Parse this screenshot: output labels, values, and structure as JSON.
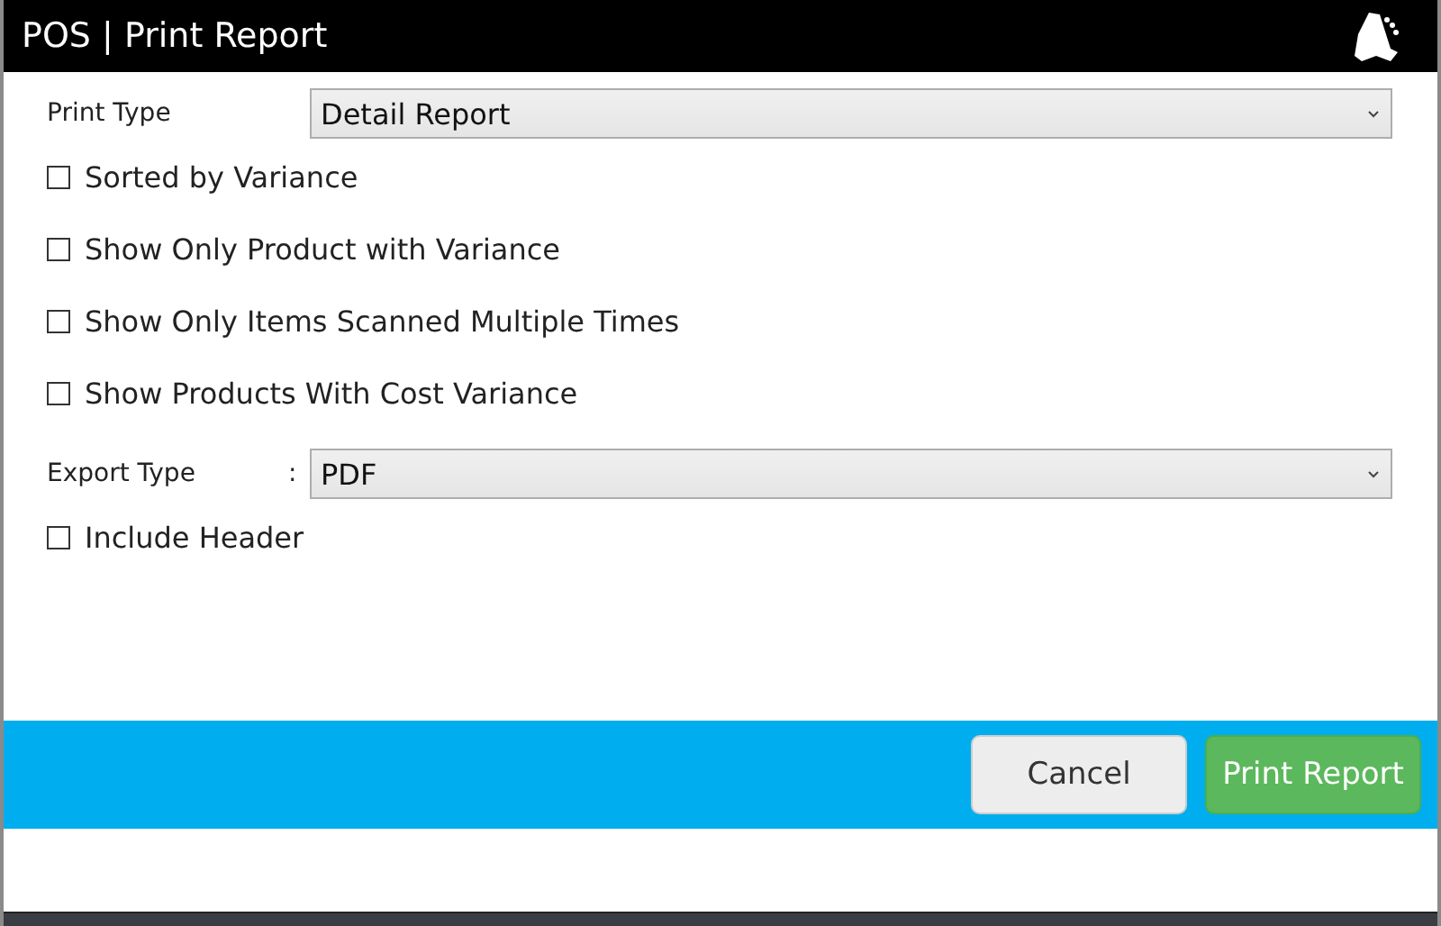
{
  "window": {
    "title": "POS | Print Report"
  },
  "print_type": {
    "label": "Print Type",
    "value": "Detail Report"
  },
  "options": [
    {
      "label": "Sorted by Variance",
      "checked": false
    },
    {
      "label": "Show Only Product with Variance",
      "checked": false
    },
    {
      "label": "Show Only Items Scanned Multiple Times",
      "checked": false
    },
    {
      "label": "Show Products With Cost Variance",
      "checked": false
    }
  ],
  "export_type": {
    "label": "Export Type",
    "separator": ":",
    "value": "PDF"
  },
  "include_header": {
    "label": "Include Header",
    "checked": false
  },
  "buttons": [
    {
      "label": "Cancel",
      "kind": "secondary"
    },
    {
      "label": "Print Report",
      "kind": "primary"
    }
  ]
}
